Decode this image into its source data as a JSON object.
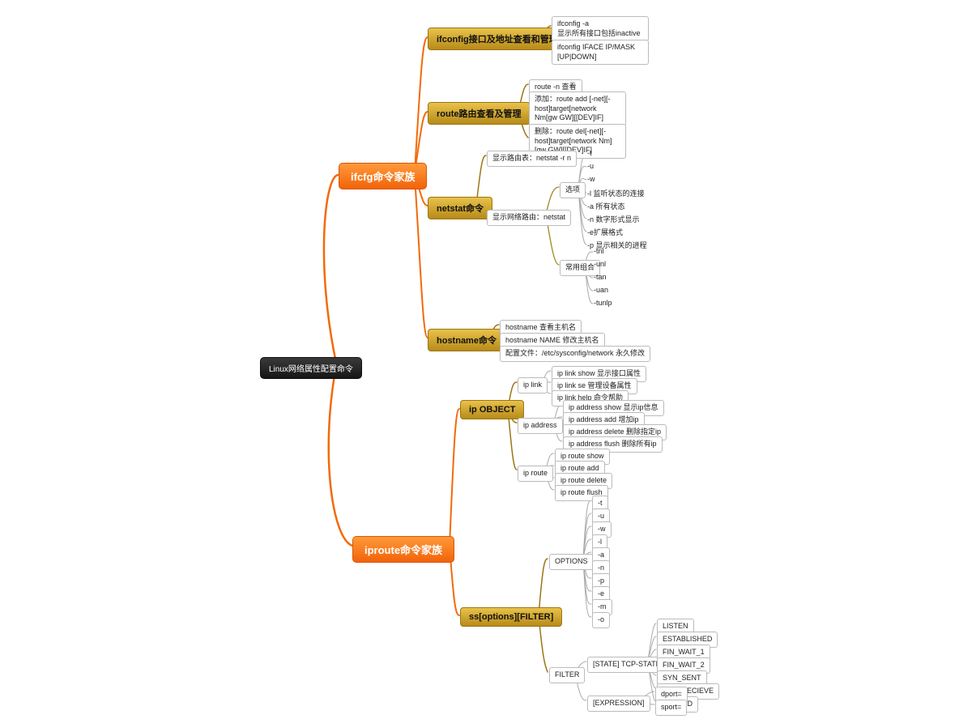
{
  "root": "Linux网络属性配置命令",
  "b1": {
    "title": "ifcfg命令家族",
    "ifconfig": {
      "title": "ifconfig接口及地址查看和管理",
      "l1": "ifconfig -a\n显示所有接口包括inactive",
      "l2": "ifconfig IFACE IP/MASK [UP|DOWN]"
    },
    "route": {
      "title": "route路由查看及管理",
      "l1": "route -n 查看",
      "l2": "添加：route add [-net][-host]target[network Nm[gw GW][[DEV]IF]",
      "l3": "删除：route del[-net][-host]target[network Nm][gw GW][[DEV]IF]"
    },
    "netstat": {
      "title": "netstat命令",
      "rt": "显示路由表：netstat -r n",
      "nr": "显示网络路由：netstat",
      "opt_label": "选项",
      "opts": {
        "o1": "-t",
        "o2": "-u",
        "o3": "-w",
        "o4": "-l 监听状态的连接",
        "o5": "-a 所有状态",
        "o6": "-n 数字形式显示",
        "o7": "-e扩展格式",
        "o8": "-p 显示相关的进程"
      },
      "combo_label": "常用组合",
      "combos": {
        "c1": "-tnl",
        "c2": "-unl",
        "c3": "-tan",
        "c4": "-uan",
        "c5": "-tunlp"
      }
    },
    "hostname": {
      "title": "hostname命令",
      "l1": "hostname 查看主机名",
      "l2": "hostname NAME 修改主机名",
      "l3": "配置文件：/etc/sysconfig/network 永久修改"
    }
  },
  "b2": {
    "title": "iproute命令家族",
    "ipobj": {
      "title": "ip OBJECT",
      "link": {
        "label": "ip link",
        "l1": "ip link show 显示接口属性",
        "l2": "ip link se  管理设备属性",
        "l3": "ip link help 命令帮助"
      },
      "addr": {
        "label": "ip address",
        "l1": "ip address show 显示ip信息",
        "l2": "ip address add 增加ip",
        "l3": "ip address delete 删除指定ip",
        "l4": "ip address flush 删除所有ip"
      },
      "route": {
        "label": "ip route",
        "l1": "ip route show",
        "l2": "ip route add",
        "l3": "ip route delete",
        "l4": "ip route flush"
      }
    },
    "ss": {
      "title": "ss[options][FILTER]",
      "opt_label": "OPTIONS",
      "opts": {
        "s1": "-t",
        "s2": "-u",
        "s3": "-w",
        "s4": "-l",
        "s5": "-a",
        "s6": "-n",
        "s7": "-p",
        "s8": "-e",
        "s9": "-m",
        "s10": "-o"
      },
      "filter_label": "FILTER",
      "state_label": "[STATE] TCP-STATE",
      "states": {
        "t1": "LISTEN",
        "t2": "ESTABLISHED",
        "t3": "FIN_WAIT_1",
        "t4": "FIN_WAIT_2",
        "t5": "SYN_SENT",
        "t6": "SYN_RECIEVE",
        "t7": "CLOSED"
      },
      "expr_label": "[EXPRESSION]",
      "exprs": {
        "e1": "dport=",
        "e2": "sport="
      }
    }
  }
}
